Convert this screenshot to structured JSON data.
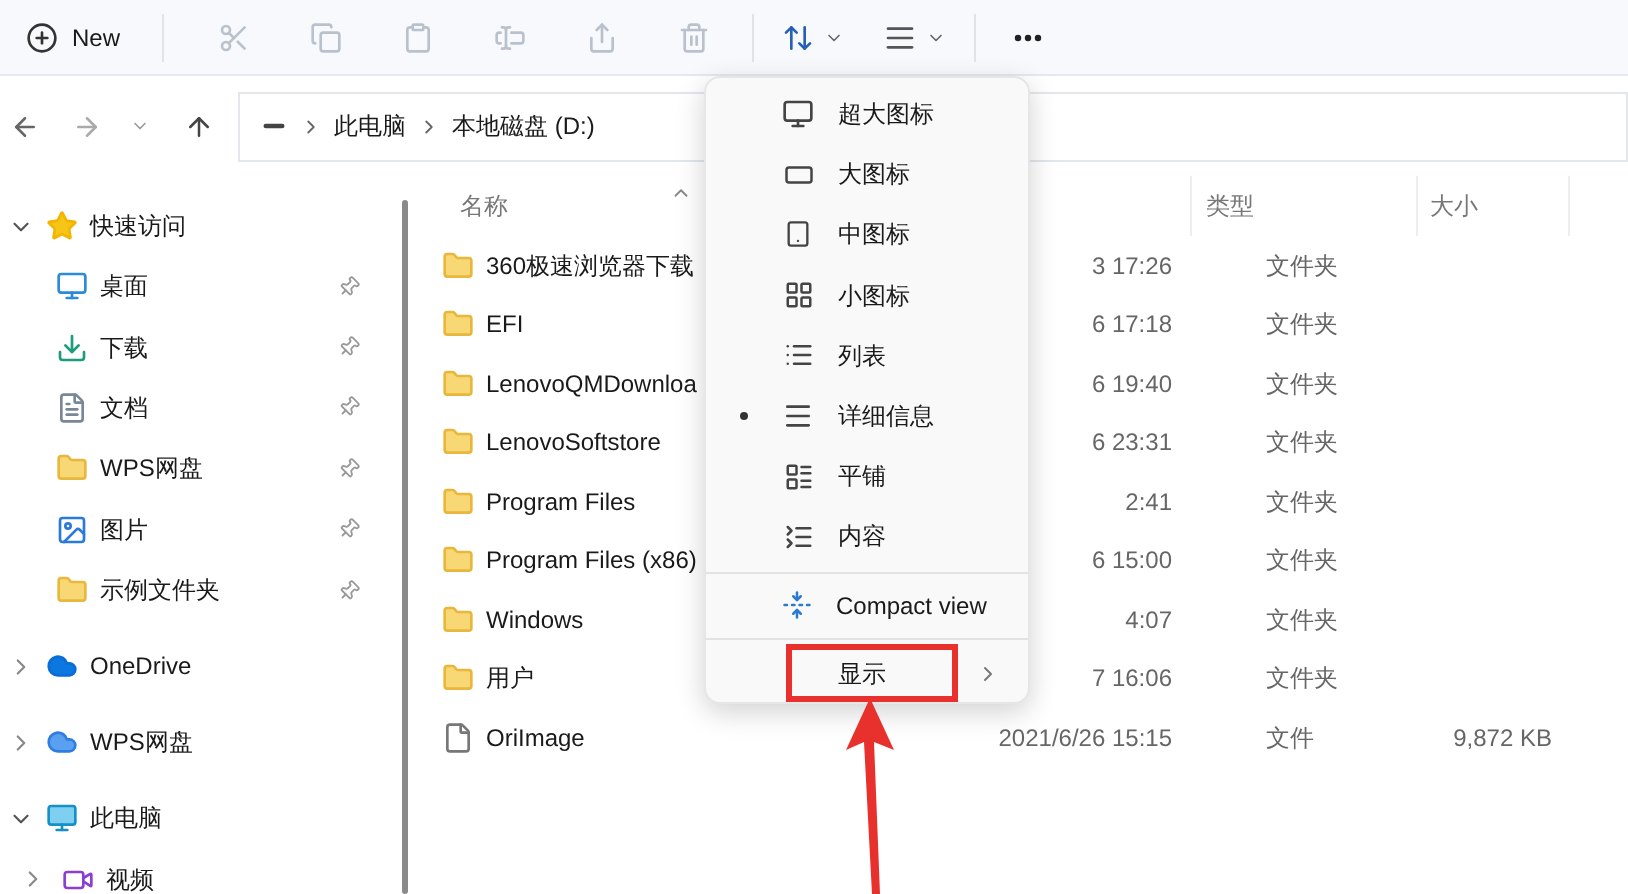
{
  "toolbar": {
    "new_label": "New"
  },
  "address": {
    "segments": [
      "此电脑",
      "本地磁盘 (D:)"
    ]
  },
  "sidebar": {
    "items": [
      {
        "label": "快速访问",
        "kind": "star",
        "expanded": true,
        "children": [
          {
            "label": "桌面",
            "kind": "desktop",
            "pinned": true
          },
          {
            "label": "下载",
            "kind": "download",
            "pinned": true
          },
          {
            "label": "文档",
            "kind": "document",
            "pinned": true
          },
          {
            "label": "WPS网盘",
            "kind": "folder",
            "pinned": true
          },
          {
            "label": "图片",
            "kind": "picture",
            "pinned": true
          },
          {
            "label": "示例文件夹",
            "kind": "folder",
            "pinned": true
          }
        ]
      },
      {
        "label": "OneDrive",
        "kind": "cloud",
        "expanded": false
      },
      {
        "label": "WPS网盘",
        "kind": "cloud2",
        "expanded": false
      },
      {
        "label": "此电脑",
        "kind": "pc",
        "expanded": true,
        "children": [
          {
            "label": "视频",
            "kind": "video",
            "expanded": false
          }
        ]
      }
    ]
  },
  "table": {
    "columns": [
      "名称",
      "类型",
      "大小"
    ],
    "rows": [
      {
        "name": "360极速浏览器下载",
        "kind": "folder",
        "column_2": "3 17:26",
        "type": "文件夹"
      },
      {
        "name": "EFI",
        "kind": "folder",
        "column_2": "6 17:18",
        "type": "文件夹"
      },
      {
        "name": "LenovoQMDownloa",
        "kind": "folder",
        "column_2": "6 19:40",
        "type": "文件夹"
      },
      {
        "name": "LenovoSoftstore",
        "kind": "folder",
        "column_2": "6 23:31",
        "type": "文件夹"
      },
      {
        "name": "Program Files",
        "kind": "folder",
        "column_2": "2:41",
        "type": "文件夹"
      },
      {
        "name": "Program Files (x86)",
        "kind": "folder",
        "column_2": "6 15:00",
        "type": "文件夹"
      },
      {
        "name": "Windows",
        "kind": "folder",
        "column_2": "4:07",
        "type": "文件夹"
      },
      {
        "name": "用户",
        "kind": "folder",
        "column_2": "7 16:06",
        "type": "文件夹"
      },
      {
        "name": "OriImage",
        "kind": "file",
        "column_2": "2021/6/26 15:15",
        "type": "文件",
        "size": "9,872 KB"
      }
    ]
  },
  "view_menu": {
    "items": [
      {
        "label": "超大图标",
        "kind": "xl",
        "selected": false
      },
      {
        "label": "大图标",
        "kind": "large",
        "selected": false
      },
      {
        "label": "中图标",
        "kind": "medium",
        "selected": false
      },
      {
        "label": "小图标",
        "kind": "small",
        "selected": false
      },
      {
        "label": "列表",
        "kind": "list",
        "selected": false
      },
      {
        "label": "详细信息",
        "kind": "details",
        "selected": true
      },
      {
        "label": "平铺",
        "kind": "tiles",
        "selected": false
      },
      {
        "label": "内容",
        "kind": "content",
        "selected": false
      }
    ],
    "compact_label": "Compact view",
    "submenu_label": "显示",
    "highlighted": true
  }
}
